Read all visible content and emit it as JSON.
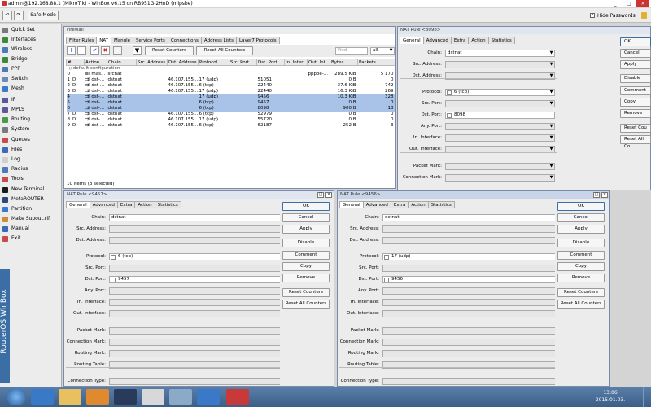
{
  "titlebar": {
    "title": "admin@192.168.88.1 (MikroTik) - WinBox v6.15 on RB951G-2HnD (mipsbe)",
    "minimize": "_",
    "maximize": "□",
    "close": "×"
  },
  "toolbar": {
    "undo": "↶",
    "redo": "↷",
    "safe_mode": "Safe Mode",
    "hide_passwords": "Hide Passwords"
  },
  "sidebar": {
    "vertical_label": "RouterOS WinBox",
    "items": [
      {
        "label": "Quick Set",
        "icon": "quickset-icon",
        "color": "#7a7a7a"
      },
      {
        "label": "Interfaces",
        "icon": "interfaces-icon",
        "color": "#3a8a3a"
      },
      {
        "label": "Wireless",
        "icon": "wireless-icon",
        "color": "#4a7ab8"
      },
      {
        "label": "Bridge",
        "icon": "bridge-icon",
        "color": "#3a8a3a"
      },
      {
        "label": "PPP",
        "icon": "ppp-icon",
        "color": "#4a7ab8"
      },
      {
        "label": "Switch",
        "icon": "switch-icon",
        "color": "#6a8ab8"
      },
      {
        "label": "Mesh",
        "icon": "mesh-icon",
        "color": "#3a7ac8"
      },
      {
        "label": "IP",
        "icon": "ip-icon",
        "color": "#5a5a9a"
      },
      {
        "label": "MPLS",
        "icon": "mpls-icon",
        "color": "#5a5a9a"
      },
      {
        "label": "Routing",
        "icon": "routing-icon",
        "color": "#4a9a4a"
      },
      {
        "label": "System",
        "icon": "system-icon",
        "color": "#7a7a7a"
      },
      {
        "label": "Queues",
        "icon": "queues-icon",
        "color": "#c84a4a"
      },
      {
        "label": "Files",
        "icon": "files-icon",
        "color": "#3a6ab8"
      },
      {
        "label": "Log",
        "icon": "log-icon",
        "color": "#d0d0d0"
      },
      {
        "label": "Radius",
        "icon": "radius-icon",
        "color": "#4a7ab8"
      },
      {
        "label": "Tools",
        "icon": "tools-icon",
        "color": "#c84a4a"
      },
      {
        "label": "New Terminal",
        "icon": "terminal-icon",
        "color": "#1a1a1a"
      },
      {
        "label": "MetaROUTER",
        "icon": "metarouter-icon",
        "color": "#2a4a7a"
      },
      {
        "label": "Partition",
        "icon": "partition-icon",
        "color": "#3a7ac8"
      },
      {
        "label": "Make Supout.rif",
        "icon": "supout-icon",
        "color": "#d08a3a"
      },
      {
        "label": "Manual",
        "icon": "manual-icon",
        "color": "#3a6ab8"
      },
      {
        "label": "Exit",
        "icon": "exit-icon",
        "color": "#c84a4a"
      }
    ]
  },
  "firewall": {
    "title": "Firewall",
    "tabs": [
      "Filter Rules",
      "NAT",
      "Mangle",
      "Service Ports",
      "Connections",
      "Address Lists",
      "Layer7 Protocols"
    ],
    "selected_tab": 1,
    "reset_counters": "Reset Counters",
    "reset_all_counters": "Reset All Counters",
    "find_placeholder": "Find",
    "filter_value": "all",
    "columns": [
      "#",
      "Action",
      "Chain",
      "Src. Address",
      "Dst. Address",
      "Protocol",
      "Src. Port",
      "Dst. Port",
      "In. Inter...",
      "Out. Int...",
      "Bytes",
      "Packets"
    ],
    "comment": ";;; default configuration",
    "rows": [
      {
        "n": "0",
        "flag": "",
        "action": "≡l mas...",
        "chain": "srcnat",
        "src": "",
        "dst": "",
        "proto": "",
        "sport": "",
        "dport": "",
        "inif": "",
        "outif": "pppoe-...",
        "bytes": "289.5 KiB",
        "packets": "5 170",
        "sel": false
      },
      {
        "n": "1",
        "flag": "D",
        "action": "⇉l dst-...",
        "chain": "dstnat",
        "src": "",
        "dst": "46.107.155....",
        "proto": "17 (udp)",
        "sport": "",
        "dport": "51051",
        "inif": "",
        "outif": "",
        "bytes": "0 B",
        "packets": "0",
        "sel": false
      },
      {
        "n": "2",
        "flag": "D",
        "action": "⇉l dst-...",
        "chain": "dstnat",
        "src": "",
        "dst": "46.107.155....",
        "proto": "6 (tcp)",
        "sport": "",
        "dport": "22440",
        "inif": "",
        "outif": "",
        "bytes": "37.6 KiB",
        "packets": "742",
        "sel": false
      },
      {
        "n": "3",
        "flag": "D",
        "action": "⇉l dst-...",
        "chain": "dstnat",
        "src": "",
        "dst": "46.107.155....",
        "proto": "17 (udp)",
        "sport": "",
        "dport": "22440",
        "inif": "",
        "outif": "",
        "bytes": "16.3 KiB",
        "packets": "269",
        "sel": false
      },
      {
        "n": "4",
        "flag": "",
        "action": "⇉l dst-...",
        "chain": "dstnat",
        "src": "",
        "dst": "",
        "proto": "17 (udp)",
        "sport": "",
        "dport": "9456",
        "inif": "",
        "outif": "",
        "bytes": "10.3 KiB",
        "packets": "328",
        "sel": true
      },
      {
        "n": "5",
        "flag": "",
        "action": "⇉l dst-...",
        "chain": "dstnat",
        "src": "",
        "dst": "",
        "proto": "6 (tcp)",
        "sport": "",
        "dport": "9457",
        "inif": "",
        "outif": "",
        "bytes": "0 B",
        "packets": "0",
        "sel": true
      },
      {
        "n": "6",
        "flag": "",
        "action": "⇉l dst-...",
        "chain": "dstnat",
        "src": "",
        "dst": "",
        "proto": "6 (tcp)",
        "sport": "",
        "dport": "8098",
        "inif": "",
        "outif": "",
        "bytes": "900 B",
        "packets": "18",
        "sel": true
      },
      {
        "n": "7",
        "flag": "D",
        "action": "⇉l dst-...",
        "chain": "dstnat",
        "src": "",
        "dst": "46.107.155....",
        "proto": "6 (tcp)",
        "sport": "",
        "dport": "52979",
        "inif": "",
        "outif": "",
        "bytes": "0 B",
        "packets": "0",
        "sel": false
      },
      {
        "n": "8",
        "flag": "D",
        "action": "⇉l dst-...",
        "chain": "dstnat",
        "src": "",
        "dst": "46.107.155....",
        "proto": "17 (udp)",
        "sport": "",
        "dport": "55720",
        "inif": "",
        "outif": "",
        "bytes": "0 B",
        "packets": "0",
        "sel": false
      },
      {
        "n": "9",
        "flag": "D",
        "action": "⇉l dst-...",
        "chain": "dstnat",
        "src": "",
        "dst": "46.107.155....",
        "proto": "6 (tcp)",
        "sport": "",
        "dport": "62187",
        "inif": "",
        "outif": "",
        "bytes": "252 B",
        "packets": "3",
        "sel": false
      }
    ],
    "status": "10 items (3 selected)"
  },
  "labels": {
    "chain": "Chain:",
    "src_address": "Src. Address:",
    "dst_address": "Dst. Address:",
    "protocol": "Protocol:",
    "src_port": "Src. Port:",
    "dst_port": "Dst. Port:",
    "any_port": "Any. Port:",
    "in_interface": "In. Interface:",
    "out_interface": "Out. Interface:",
    "packet_mark": "Packet Mark:",
    "connection_mark": "Connection Mark:",
    "routing_mark": "Routing Mark:",
    "routing_table": "Routing Table:",
    "connection_type": "Connection Type:"
  },
  "rule_tabs": [
    "General",
    "Advanced",
    "Extra",
    "Action",
    "Statistics"
  ],
  "buttons": {
    "ok": "OK",
    "cancel": "Cancel",
    "apply": "Apply",
    "disable": "Disable",
    "comment": "Comment",
    "copy": "Copy",
    "remove": "Remove",
    "reset_counters": "Reset Counters",
    "reset_all_counters": "Reset All Counters"
  },
  "rule_8098": {
    "title": "NAT Rule <8098>",
    "chain": "dstnat",
    "protocol": "6 (tcp)",
    "dst_port": "8098",
    "buttons": {
      "ok": "OK",
      "cancel": "Cancel",
      "apply": "Apply",
      "disable": "Disable",
      "comment": "Comment",
      "copy": "Copy",
      "remove": "Remove",
      "reset_counters": "Reset Cou",
      "reset_all_counters": "Reset All Co"
    }
  },
  "rule_9457": {
    "title": "NAT Rule <9457>",
    "chain": "dstnat",
    "protocol": "6 (tcp)",
    "dst_port": "9457"
  },
  "rule_9456": {
    "title": "NAT Rule <9456>",
    "chain": "dstnat",
    "protocol": "17 (udp)",
    "dst_port": "9456"
  },
  "taskbar": {
    "time": "13:06",
    "date": "2015.01.03."
  }
}
